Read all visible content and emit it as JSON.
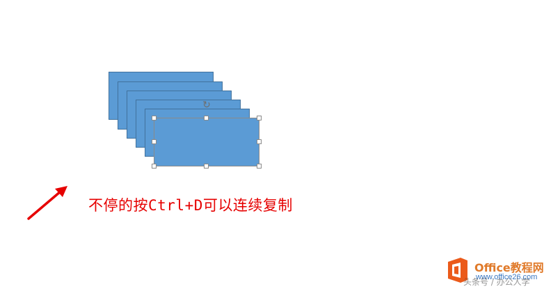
{
  "slide": {
    "instruction_text": "不停的按Ctrl+D可以连续复制",
    "shape_fill_color": "#5b9bd5",
    "shape_border_color": "#41719c",
    "instruction_color": "#e60000",
    "shape_copies": 6,
    "icons": {
      "rotate": "rotate-handle-icon",
      "arrow": "pointer-arrow-icon"
    }
  },
  "watermark": {
    "brand": "Office教程网",
    "url": "www.office26.com",
    "credit": "头条号 / 办公人学"
  }
}
